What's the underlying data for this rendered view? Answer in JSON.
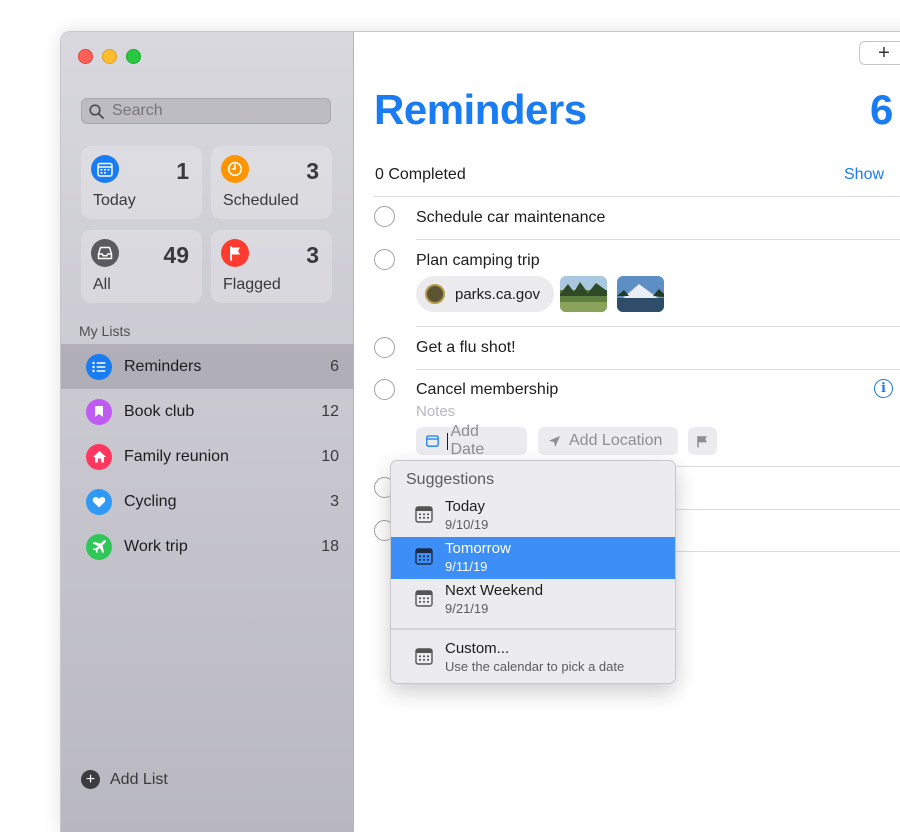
{
  "sidebar": {
    "search": {
      "placeholder": "Search"
    },
    "smart_lists": [
      {
        "label": "Today",
        "count": "1",
        "icon": "calendar-icon",
        "color": "#1a7cf2"
      },
      {
        "label": "Scheduled",
        "count": "3",
        "icon": "clock-icon",
        "color": "#ff9500"
      },
      {
        "label": "All",
        "count": "49",
        "icon": "tray-icon",
        "color": "#5a5a5f"
      },
      {
        "label": "Flagged",
        "count": "3",
        "icon": "flag-icon",
        "color": "#ff3b30"
      }
    ],
    "my_lists_label": "My Lists",
    "lists": [
      {
        "name": "Reminders",
        "count": "6",
        "icon": "list-icon",
        "color": "#1a7cf2"
      },
      {
        "name": "Book club",
        "count": "12",
        "icon": "bookmark-icon",
        "color": "#bf5af2"
      },
      {
        "name": "Family reunion",
        "count": "10",
        "icon": "house-icon",
        "color": "#ff375f"
      },
      {
        "name": "Cycling",
        "count": "3",
        "icon": "heart-icon",
        "color": "#2f9af5"
      },
      {
        "name": "Work trip",
        "count": "18",
        "icon": "airplane-icon",
        "color": "#30c759"
      }
    ],
    "add_list_label": "Add List"
  },
  "main": {
    "add_button": "+",
    "title": "Reminders",
    "count": "6",
    "completed_label": "0 Completed",
    "show_label": "Show",
    "reminders": [
      {
        "title": "Schedule car maintenance"
      },
      {
        "title": "Plan camping trip",
        "link": "parks.ca.gov"
      },
      {
        "title": "Get a flu shot!"
      },
      {
        "title": "Cancel membership",
        "notes_placeholder": "Notes"
      }
    ],
    "chips": {
      "add_date": "Add Date",
      "add_location": "Add Location"
    }
  },
  "popup": {
    "header": "Suggestions",
    "items": [
      {
        "label": "Today",
        "date": "9/10/19"
      },
      {
        "label": "Tomorrow",
        "date": "9/11/19",
        "selected": true
      },
      {
        "label": "Next Weekend",
        "date": "9/21/19"
      },
      {
        "label": "Custom...",
        "date": "Use the calendar to pick a date"
      }
    ]
  },
  "colors": {
    "accent": "#1a7cf2",
    "highlight": "#3d8ef7"
  }
}
